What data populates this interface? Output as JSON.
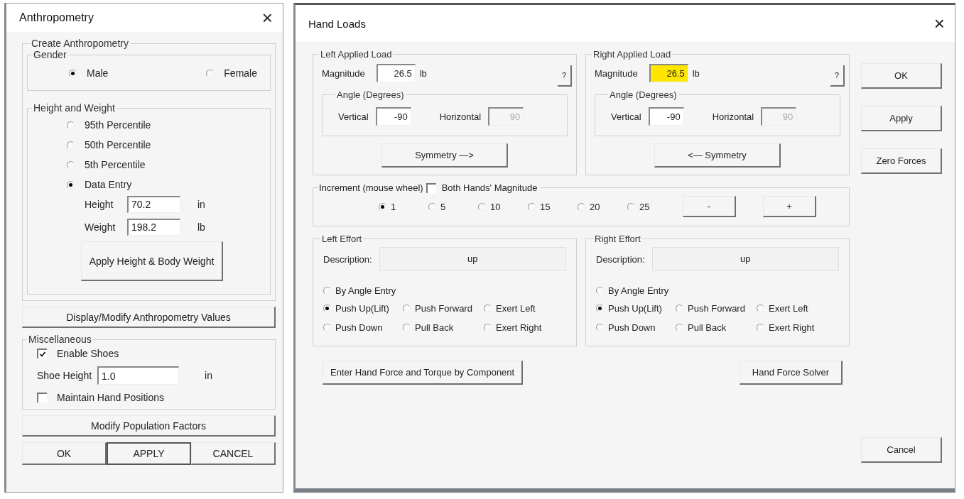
{
  "anthropometry": {
    "title": "Anthropometry",
    "close": "×",
    "create_group": {
      "title": "Create Anthropometry",
      "gender": {
        "title": "Gender",
        "options": [
          {
            "label": "Male",
            "selected": true
          },
          {
            "label": "Female",
            "selected": false
          }
        ]
      },
      "height_weight": {
        "title": "Height and Weight",
        "options": [
          {
            "label": "95th Percentile",
            "selected": false
          },
          {
            "label": "50th Percentile",
            "selected": false
          },
          {
            "label": "5th  Percentile",
            "selected": false
          },
          {
            "label": "Data Entry",
            "selected": true
          }
        ],
        "fields": [
          {
            "label": "Height",
            "value": "70.2",
            "unit": "in"
          },
          {
            "label": "Weight",
            "value": "198.2",
            "unit": "lb"
          }
        ],
        "apply_button": "Apply Height & Body Weight"
      }
    },
    "display_button": "Display/Modify Anthropometry Values",
    "misc": {
      "title": "Miscellaneous",
      "items": [
        {
          "kind": "checkbox",
          "label": "Enable Shoes",
          "checked": true
        },
        {
          "kind": "field",
          "label": "Shoe Height",
          "value": "1.0",
          "unit": "in"
        },
        {
          "kind": "checkbox",
          "label": "Maintain Hand Positions",
          "checked": false
        }
      ]
    },
    "population_button": "Modify Population Factors",
    "buttons": [
      {
        "label": "OK",
        "default": false
      },
      {
        "label": "APPLY",
        "default": true
      },
      {
        "label": "CANCEL",
        "default": false
      }
    ]
  },
  "hand_loads": {
    "title": "Hand Loads",
    "close": "×",
    "loads": [
      {
        "title": "Left Applied Load",
        "help": "?",
        "magnitude": {
          "label": "Magnitude",
          "value": "26.5",
          "unit": "lb",
          "highlighted": false
        },
        "angle": {
          "title": "Angle (Degrees)",
          "fields": [
            {
              "label": "Vertical",
              "value": "-90",
              "disabled": false
            },
            {
              "label": "Horizontal",
              "value": "90",
              "disabled": true
            }
          ]
        },
        "symmetry_button": "Symmetry —>"
      },
      {
        "title": "Right Applied Load",
        "help": "?",
        "magnitude": {
          "label": "Magnitude",
          "value": "26.5",
          "unit": "lb",
          "highlighted": true
        },
        "angle": {
          "title": "Angle (Degrees)",
          "fields": [
            {
              "label": "Vertical",
              "value": "-90",
              "disabled": false
            },
            {
              "label": "Horizontal",
              "value": "90",
              "disabled": true
            }
          ]
        },
        "symmetry_button": "<— Symmetry"
      }
    ],
    "side_buttons": [
      "OK",
      "Apply",
      "Zero Forces"
    ],
    "increment": {
      "title": "Increment (mouse wheel)",
      "both_hands": {
        "label": "Both Hands' Magnitude",
        "checked": false
      },
      "options": [
        {
          "label": "1",
          "selected": true
        },
        {
          "label": "5",
          "selected": false
        },
        {
          "label": "10",
          "selected": false
        },
        {
          "label": "15",
          "selected": false
        },
        {
          "label": "20",
          "selected": false
        },
        {
          "label": "25",
          "selected": false
        }
      ],
      "buttons": [
        "-",
        "+"
      ]
    },
    "efforts": [
      {
        "title": "Left Effort",
        "description": {
          "label": "Description:",
          "value": "up"
        },
        "angle_entry": {
          "label": "By Angle Entry",
          "selected": false
        },
        "directions": [
          {
            "label": "Push Up(Lift)",
            "selected": true
          },
          {
            "label": "Push Forward",
            "selected": false
          },
          {
            "label": "Exert Left",
            "selected": false
          },
          {
            "label": "Push Down",
            "selected": false
          },
          {
            "label": "Pull Back",
            "selected": false
          },
          {
            "label": "Exert Right",
            "selected": false
          }
        ]
      },
      {
        "title": "Right Effort",
        "description": {
          "label": "Description:",
          "value": "up"
        },
        "angle_entry": {
          "label": "By Angle Entry",
          "selected": false
        },
        "directions": [
          {
            "label": "Push Up(Lift)",
            "selected": true
          },
          {
            "label": "Push Forward",
            "selected": false
          },
          {
            "label": "Exert Left",
            "selected": false
          },
          {
            "label": "Push Down",
            "selected": false
          },
          {
            "label": "Pull Back",
            "selected": false
          },
          {
            "label": "Exert Right",
            "selected": false
          }
        ]
      }
    ],
    "component_button": "Enter Hand Force and Torque by Component",
    "solver_button": "Hand Force Solver",
    "cancel_button": "Cancel"
  }
}
